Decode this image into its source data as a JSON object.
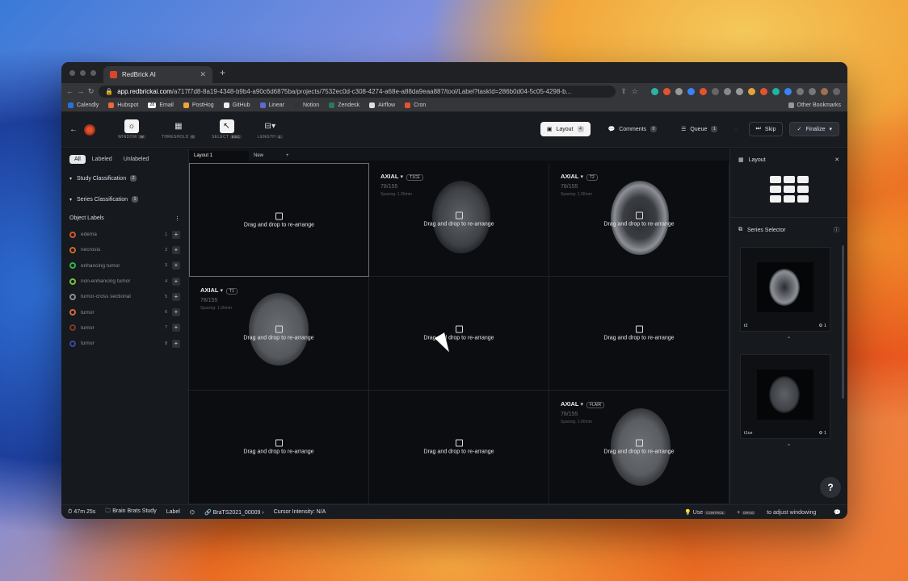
{
  "browser": {
    "tab_title": "RedBrick AI",
    "url_host": "app.redbrickai.com",
    "url_path": "/a717f7d8-8a19-4348-b9b4-a90c6d6875ba/projects/7532ec0d-c308-4274-a68e-a88da9eaa887/tool/Label?taskId=286b0d04-5c05-4298-b...",
    "bookmarks": [
      "Calendly",
      "Hubspot",
      "Email",
      "PostHog",
      "GitHub",
      "Linear",
      "Notion",
      "Zendesk",
      "Airflow",
      "Cron"
    ],
    "bookmark_badge": "28",
    "other_bookmarks": "Other Bookmarks"
  },
  "toolbar": {
    "window": "WINDOW",
    "window_key": "W",
    "threshold": "THRESHOLD",
    "threshold_key": "0",
    "select": "SELECT",
    "select_key": "ESC",
    "length": "LENGTH",
    "length_key": "L",
    "layout": "Layout",
    "layout_count": "4",
    "comments": "Comments",
    "comments_count": "0",
    "queue": "Queue",
    "queue_count": "1",
    "skip": "Skip",
    "finalize": "Finalize"
  },
  "sidebar": {
    "filters": [
      "All",
      "Labeled",
      "Unlabeled"
    ],
    "study": "Study Classification",
    "study_count": "2",
    "series": "Series Classification",
    "series_count": "1",
    "object_labels": "Object Labels",
    "labels": [
      {
        "name": "edema",
        "key": "1",
        "color": "#d05a2a"
      },
      {
        "name": "necrosis",
        "key": "2",
        "color": "#c96a2a"
      },
      {
        "name": "enhancing tumor",
        "key": "3",
        "color": "#2fb54a"
      },
      {
        "name": "non-enhancing tumor",
        "key": "4",
        "color": "#7bbf3a"
      },
      {
        "name": "tumor-cross sectional",
        "key": "5",
        "color": "#8a8f96"
      },
      {
        "name": "tumor",
        "key": "6",
        "color": "#d06a3a"
      },
      {
        "name": "tumor",
        "key": "7",
        "color": "#7a3a2a"
      },
      {
        "name": "tumor",
        "key": "8",
        "color": "#3a4a9a"
      }
    ]
  },
  "layout_tabs": [
    "Layout 1",
    "New",
    "+"
  ],
  "drop_text": "Drag and drop to re-arrange",
  "viewports": [
    {
      "plane": "AXIAL",
      "series": "T1CE",
      "slice": "78/155",
      "spacing": "Spacing: 1.00mm"
    },
    {
      "plane": "AXIAL",
      "series": "T2",
      "slice": "78/155",
      "spacing": "Spacing: 1.00mm"
    },
    {
      "plane": "AXIAL",
      "series": "T1",
      "slice": "78/155",
      "spacing": "Spacing: 1.00mm"
    },
    {
      "plane": "AXIAL",
      "series": "FLAIR",
      "slice": "78/155",
      "spacing": "Spacing: 1.00mm"
    }
  ],
  "right_panel": {
    "layout_title": "Layout",
    "series_selector": "Series Selector",
    "thumbs": [
      {
        "name": "t2",
        "count": "1"
      },
      {
        "name": "t1ce",
        "count": "1"
      }
    ],
    "help": "?"
  },
  "status": {
    "timer": "47m 25s",
    "study": "Brain Brats Study",
    "mode": "Label",
    "task": "BraTS2021_00009",
    "intensity": "Cursor Intensity: N/A",
    "hint_pre": "Use",
    "hint_k1": "CONTROL",
    "hint_plus": "+",
    "hint_k2": "DRAG",
    "hint_post": "to adjust windowing"
  }
}
